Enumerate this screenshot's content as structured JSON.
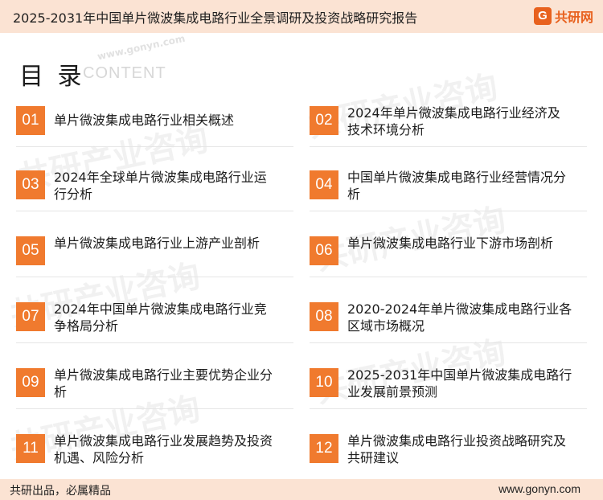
{
  "header": {
    "title": "2025-2031年中国单片微波集成电路行业全景调研及投资战略研究报告",
    "logo_mark": "G",
    "logo_text": "共研网"
  },
  "watermark": {
    "text": "共研产业咨询",
    "url": "www.gonyn.com"
  },
  "toc": {
    "heading": "目 录",
    "subheading": "CONTENT",
    "items": [
      {
        "number": "01",
        "label": "单片微波集成电路行业相关概述"
      },
      {
        "number": "02",
        "label": "2024年单片微波集成电路行业经济及技术环境分析"
      },
      {
        "number": "03",
        "label": "2024年全球单片微波集成电路行业运行分析"
      },
      {
        "number": "04",
        "label": "中国单片微波集成电路行业经营情况分析"
      },
      {
        "number": "05",
        "label": "单片微波集成电路行业上游产业剖析"
      },
      {
        "number": "06",
        "label": "单片微波集成电路行业下游市场剖析"
      },
      {
        "number": "07",
        "label": "2024年中国单片微波集成电路行业竞争格局分析"
      },
      {
        "number": "08",
        "label": "2020-2024年单片微波集成电路行业各区域市场概况"
      },
      {
        "number": "09",
        "label": "单片微波集成电路行业主要优势企业分析"
      },
      {
        "number": "10",
        "label": "2025-2031年中国单片微波集成电路行业发展前景预测"
      },
      {
        "number": "11",
        "label": "单片微波集成电路行业发展趋势及投资机遇、风险分析"
      },
      {
        "number": "12",
        "label": "单片微波集成电路行业投资战略研究及共研建议"
      }
    ]
  },
  "footer": {
    "left": "共研出品，必属精品",
    "right": "www.gonyn.com"
  },
  "colors": {
    "accent": "#f07a2e",
    "band": "#fbe3d3"
  }
}
